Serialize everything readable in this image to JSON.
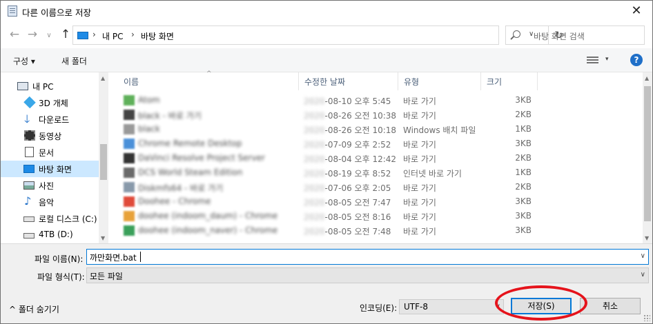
{
  "window": {
    "title": "다른 이름으로 저장",
    "close": "✕"
  },
  "nav": {
    "back": "←",
    "forward": "→",
    "up": "↑",
    "recent": "∨",
    "breadcrumb": [
      "내 PC",
      "바탕 화면"
    ],
    "breadcrumb_sep": "›",
    "dropdown": "∨",
    "refresh": "↻",
    "search_placeholder": "바탕 화면 검색"
  },
  "command": {
    "organize": "구성 ▾",
    "new_folder": "새 폴더",
    "view_dropdown": "▾",
    "help": "?"
  },
  "sidebar": {
    "items": [
      {
        "label": "내 PC",
        "icon": "pc-icon"
      },
      {
        "label": "3D 개체",
        "icon": "cube-icon"
      },
      {
        "label": "다운로드",
        "icon": "download-icon"
      },
      {
        "label": "동영상",
        "icon": "film-icon"
      },
      {
        "label": "문서",
        "icon": "document-icon"
      },
      {
        "label": "바탕 화면",
        "icon": "desktop-icon",
        "selected": true
      },
      {
        "label": "사진",
        "icon": "pictures-icon"
      },
      {
        "label": "음악",
        "icon": "music-icon"
      },
      {
        "label": "로컬 디스크 (C:)",
        "icon": "drive-icon"
      },
      {
        "label": "4TB (D:)",
        "icon": "drive-icon"
      }
    ],
    "scroll_up": "▲",
    "scroll_down": "▼"
  },
  "files": {
    "columns": [
      "이름",
      "수정한 날짜",
      "유형",
      "크기"
    ],
    "sort_indicator": "^",
    "rows": [
      {
        "name": "Atom",
        "year": "2020",
        "date": "-08-10 오후 5:45",
        "type": "바로 가기",
        "size": "3KB"
      },
      {
        "name": "black - 바로 가기",
        "year": "2020",
        "date": "-08-26 오전 10:38",
        "type": "바로 가기",
        "size": "2KB"
      },
      {
        "name": "black",
        "year": "2020",
        "date": "-08-26 오전 10:18",
        "type": "Windows 배치 파일",
        "size": "1KB"
      },
      {
        "name": "Chrome Remote Desktop",
        "year": "2020",
        "date": "-07-09 오후 2:52",
        "type": "바로 가기",
        "size": "3KB"
      },
      {
        "name": "DaVinci Resolve Project Server",
        "year": "2020",
        "date": "-08-04 오후 12:42",
        "type": "바로 가기",
        "size": "2KB"
      },
      {
        "name": "DCS World Steam Edition",
        "year": "2020",
        "date": "-08-19 오후 8:52",
        "type": "인터넷 바로 가기",
        "size": "1KB"
      },
      {
        "name": "Diskmfs64 - 바로 가기",
        "year": "2020",
        "date": "-07-06 오후 2:05",
        "type": "바로 가기",
        "size": "2KB"
      },
      {
        "name": "Doohee - Chrome",
        "year": "2020",
        "date": "-08-05 오전 7:47",
        "type": "바로 가기",
        "size": "3KB"
      },
      {
        "name": "doohee (indoom_daum) - Chrome",
        "year": "2020",
        "date": "-08-05 오전 8:16",
        "type": "바로 가기",
        "size": "3KB"
      },
      {
        "name": "doohee (indoom_naver) - Chrome",
        "year": "2020",
        "date": "-08-05 오전 7:48",
        "type": "바로 가기",
        "size": "3KB"
      }
    ],
    "scroll_up": "▲",
    "scroll_down": "▼"
  },
  "form": {
    "filename_label": "파일 이름(N):",
    "filename_value": "까만화면.bat",
    "filetype_label": "파일 형식(T):",
    "filetype_value": "모든 파일",
    "combo_arrow": "∨",
    "hide_folders": "^  폴더 숨기기",
    "encoding_label": "인코딩(E):",
    "encoding_value": "UTF-8",
    "save": "저장(S)",
    "cancel": "취소"
  },
  "colors": {
    "selection": "#cce8ff",
    "accent": "#0078d7",
    "annotation_ring": "#e5131b"
  }
}
